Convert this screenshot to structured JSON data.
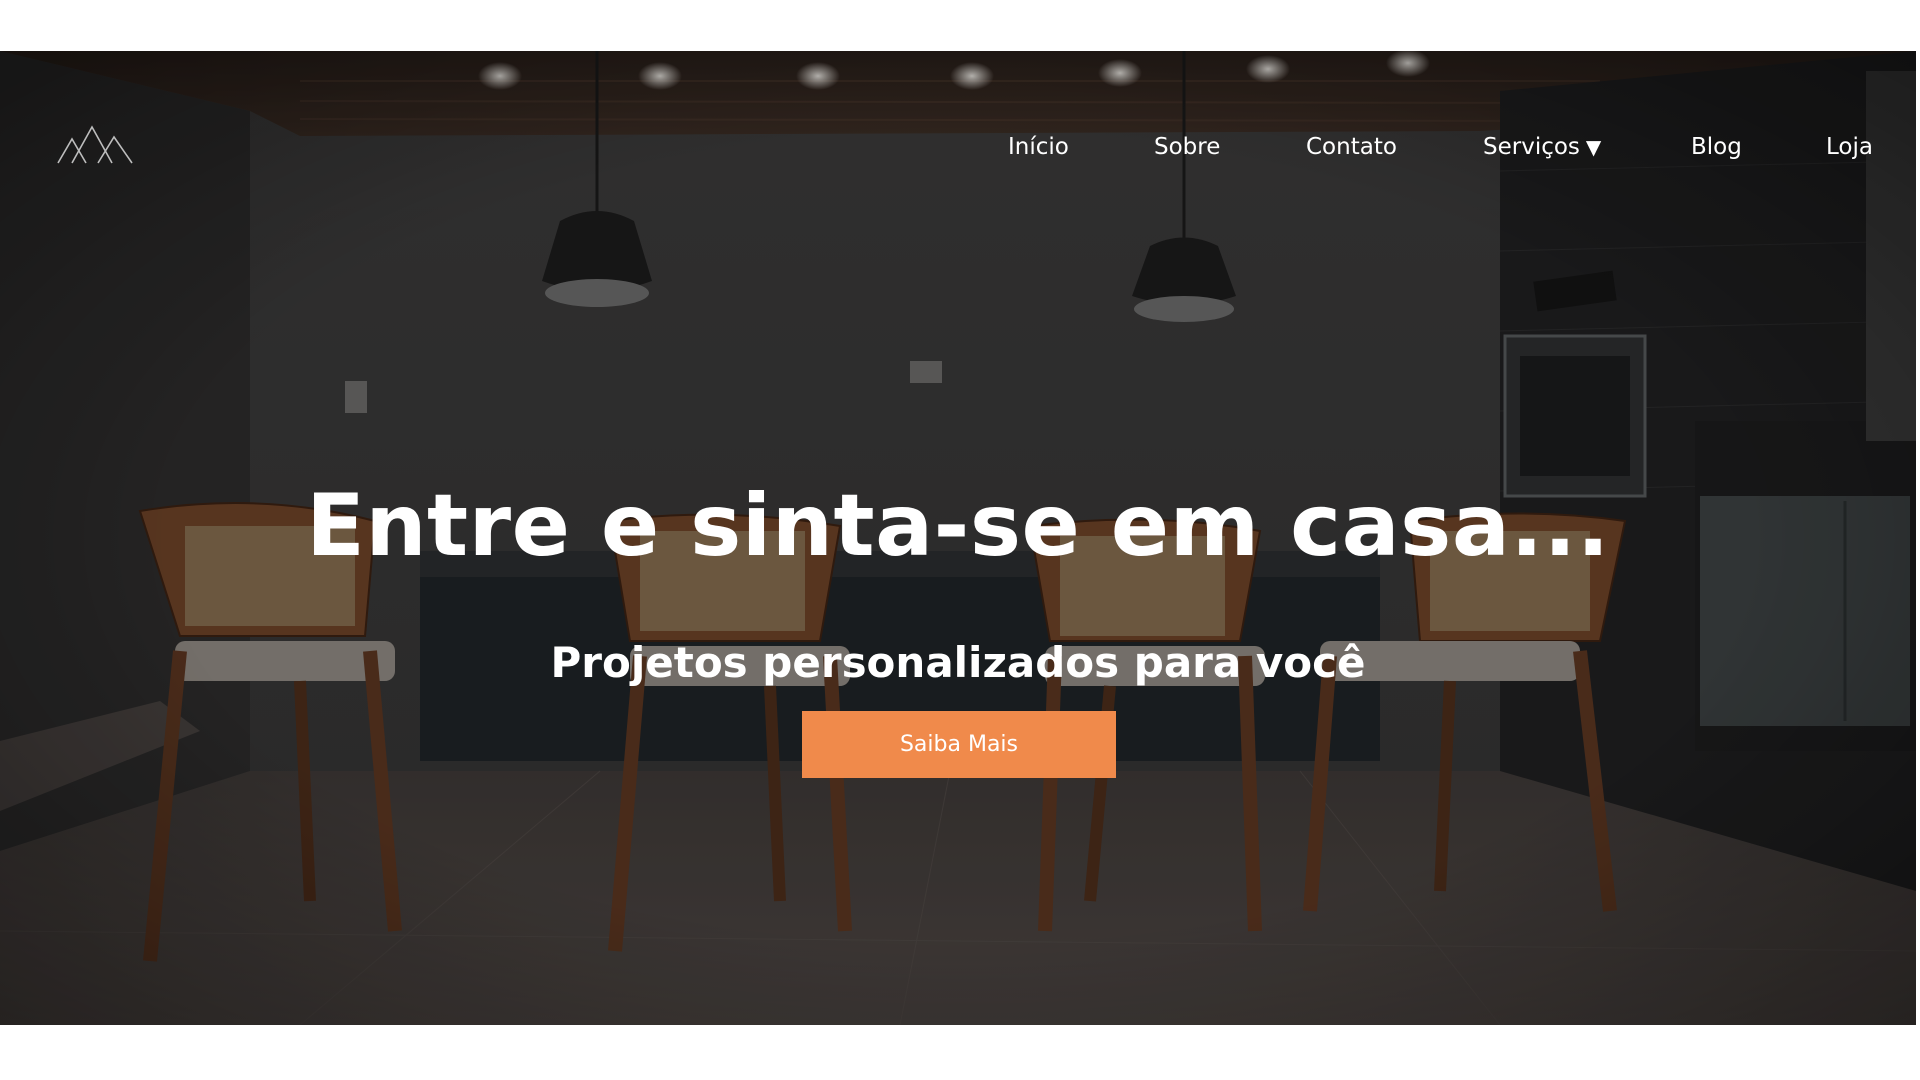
{
  "nav": {
    "items": [
      {
        "label": "Início"
      },
      {
        "label": "Sobre"
      },
      {
        "label": "Contato"
      },
      {
        "label": "Serviços",
        "dropdown_icon": "triangle-down-icon"
      },
      {
        "label": "Blog"
      },
      {
        "label": "Loja"
      }
    ]
  },
  "hero": {
    "title": "Entre e sinta-se em casa...",
    "subtitle": "Projetos personalizados para você",
    "cta_label": "Saiba Mais"
  },
  "colors": {
    "accent": "#f08a4b",
    "text": "#ffffff",
    "page_background": "#ffffff"
  },
  "icons": {
    "logo": "mountains-logo-icon"
  }
}
